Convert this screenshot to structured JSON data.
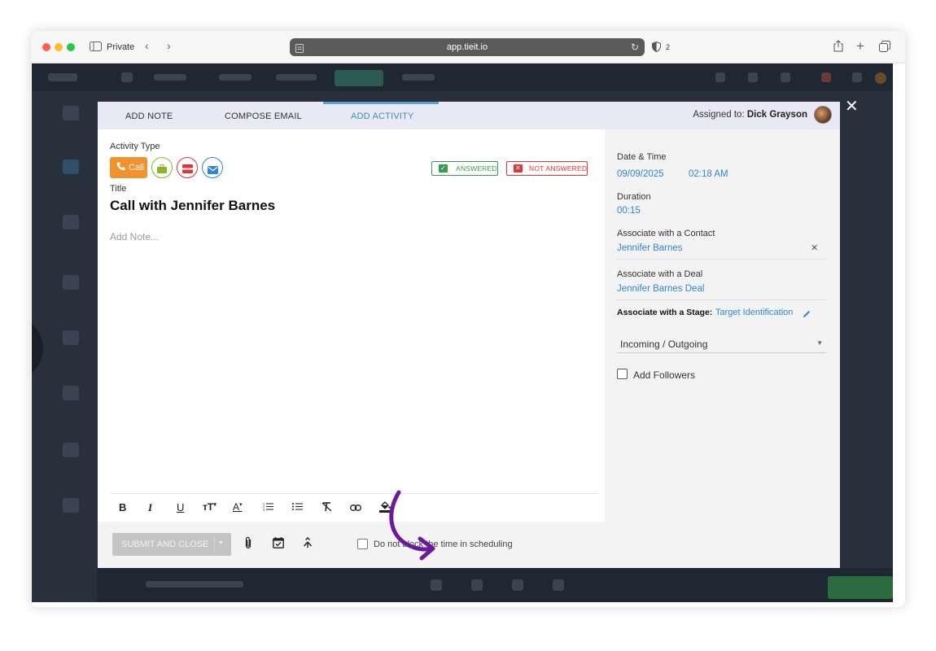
{
  "browser": {
    "private_label": "Private",
    "url": "app.tieit.io",
    "tab_count": "2"
  },
  "modal": {
    "tabs": [
      {
        "label": "ADD NOTE"
      },
      {
        "label": "COMPOSE EMAIL"
      },
      {
        "label": "ADD ACTIVITY"
      }
    ],
    "assigned_label": "Assigned to:",
    "assigned_name": "Dick Grayson",
    "activity_type_label": "Activity Type",
    "call_label": "Call",
    "answered_label": "ANSWERED",
    "not_answered_label": "NOT ANSWERED",
    "title_label": "Title",
    "title_value": "Call with Jennifer Barnes",
    "note_placeholder": "Add Note...",
    "colors": {
      "accent": "#3a8fb7",
      "call": "#f0922e",
      "answered": "#3a9a4f",
      "not_answered": "#d9373a",
      "link": "#2f86d6",
      "annotation_arrow": "#6a1a9a"
    }
  },
  "details": {
    "date_time_label": "Date & Time",
    "date": "09/09/2025",
    "time": "02:18 AM",
    "duration_label": "Duration",
    "duration": "00:15",
    "contact_label": "Associate with a Contact",
    "contact": "Jennifer Barnes",
    "deal_label": "Associate with a Deal",
    "deal": "Jennifer Barnes Deal",
    "stage_label": "Associate with a Stage:",
    "stage": "Target Identification",
    "direction_select": "Incoming / Outgoing",
    "followers_label": "Add Followers"
  },
  "footer": {
    "submit_label": "SUBMIT AND CLOSE",
    "no_block_label": "Do not block the time in scheduling"
  },
  "icons": {
    "toolbar": [
      "bold-icon",
      "italic-icon",
      "underline-icon",
      "font-size-icon",
      "font-color-icon",
      "ordered-list-icon",
      "unordered-list-icon",
      "clear-format-icon",
      "link-icon",
      "fill-color-icon"
    ],
    "footer": [
      "paperclip-icon",
      "calendar-check-icon",
      "merge-icon"
    ]
  }
}
